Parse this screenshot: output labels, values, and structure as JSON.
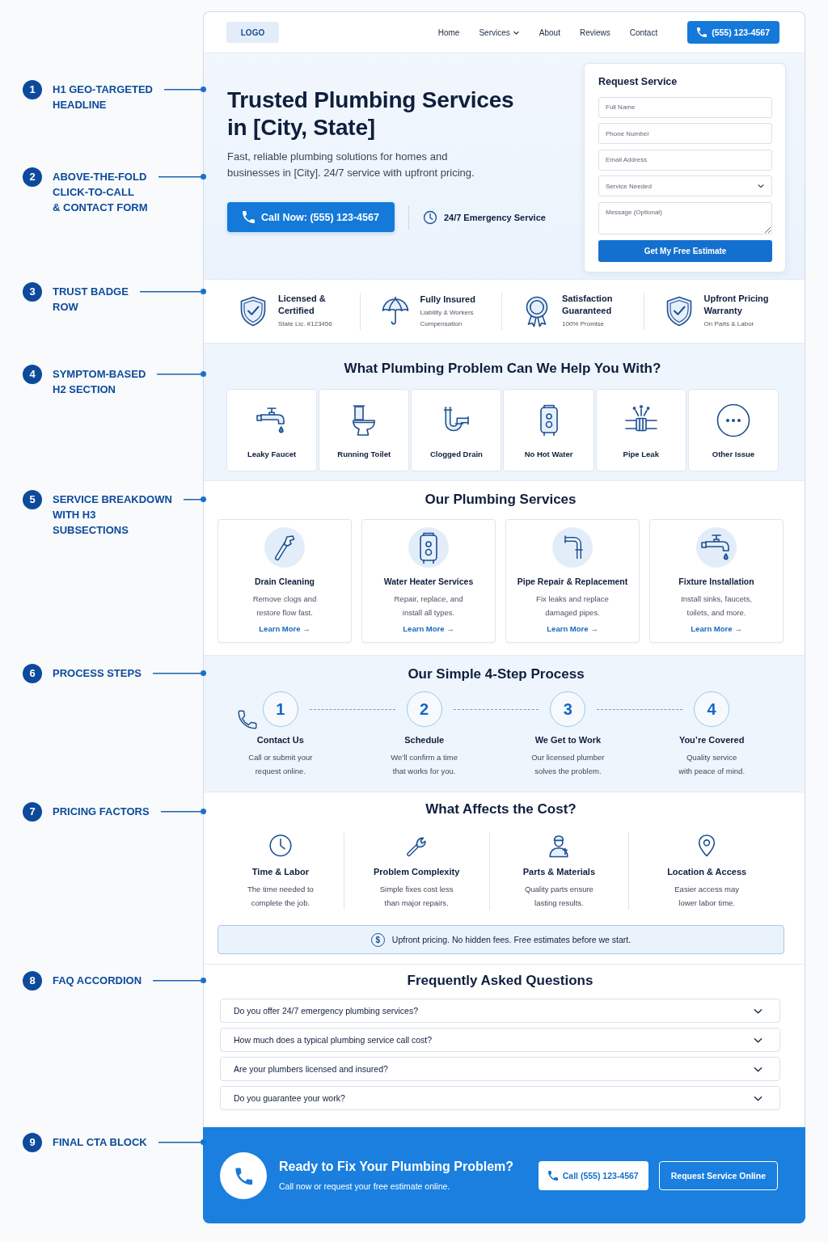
{
  "header": {
    "logo": "LOGO",
    "nav": [
      {
        "label": "Home",
        "has_menu": false
      },
      {
        "label": "Services",
        "has_menu": true
      },
      {
        "label": "About",
        "has_menu": false
      },
      {
        "label": "Reviews",
        "has_menu": false
      },
      {
        "label": "Contact",
        "has_menu": false
      }
    ],
    "phone_button": "(555) 123-4567"
  },
  "hero": {
    "annotations": [
      {
        "number": "1",
        "label": "H1 GEO-TARGETED\nHEADLINE"
      },
      {
        "number": "2",
        "label": "ABOVE-THE-FOLD\nCLICK-TO-CALL\n& CONTACT FORM"
      }
    ],
    "headline": "Trusted Plumbing Services\nin [City, State]",
    "subheadline": "Fast, reliable plumbing solutions for homes and\nbusinesses in [City]. 24/7 service with upfront pricing.",
    "call_button": "Call Now: (555) 123-4567",
    "emergency_note": "24/7 Emergency Service",
    "form": {
      "title": "Request Service",
      "fields": [
        {
          "kind": "input",
          "placeholder": "Full Name"
        },
        {
          "kind": "input",
          "placeholder": "Phone Number"
        },
        {
          "kind": "input",
          "placeholder": "Email Address"
        },
        {
          "kind": "select",
          "placeholder": "Service Needed"
        },
        {
          "kind": "textarea",
          "placeholder": "Message (Optional)"
        }
      ],
      "submit": "Get My Free Estimate"
    }
  },
  "trust_badges": {
    "annotation": {
      "number": "3",
      "label": "TRUST BADGE\nROW"
    },
    "items": [
      {
        "title": "Licensed &\nCertified",
        "subtitle": "State Lic. #123456"
      },
      {
        "title": "Fully Insured",
        "subtitle": "Liability & Workers\nCompensation"
      },
      {
        "title": "Satisfaction\nGuaranteed",
        "subtitle": "100% Promise"
      },
      {
        "title": "Upfront Pricing\nWarranty",
        "subtitle": "On Parts & Labor"
      }
    ]
  },
  "problems": {
    "annotation": {
      "number": "4",
      "label": "SYMPTOM-BASED\nH2 SECTION"
    },
    "title": "What Plumbing Problem Can We Help You With?",
    "items": [
      "Leaky Faucet",
      "Running Toilet",
      "Clogged Drain",
      "No Hot Water",
      "Pipe Leak",
      "Other Issue"
    ]
  },
  "services": {
    "annotation": {
      "number": "5",
      "label": "SERVICE BREAKDOWN\nWITH H3\nSUBSECTIONS"
    },
    "title": "Our Plumbing Services",
    "cards": [
      {
        "title": "Drain Cleaning",
        "description": "Remove clogs and\nrestore flow fast.",
        "link": "Learn More →"
      },
      {
        "title": "Water Heater Services",
        "description": "Repair, replace, and\ninstall all types.",
        "link": "Learn More →"
      },
      {
        "title": "Pipe Repair & Replacement",
        "description": "Fix leaks and replace\ndamaged pipes.",
        "link": "Learn More →"
      },
      {
        "title": "Fixture Installation",
        "description": "Install sinks, faucets,\ntoilets, and more.",
        "link": "Learn More →"
      }
    ]
  },
  "process": {
    "annotation": {
      "number": "6",
      "label": "PROCESS STEPS"
    },
    "title": "Our Simple 4-Step Process",
    "steps": [
      {
        "number": "1",
        "title": "Contact Us",
        "description": "Call or submit your\nrequest online."
      },
      {
        "number": "2",
        "title": "Schedule",
        "description": "We’ll confirm a time\nthat works for you."
      },
      {
        "number": "3",
        "title": "We Get to Work",
        "description": "Our licensed plumber\nsolves the problem."
      },
      {
        "number": "4",
        "title": "You’re Covered",
        "description": "Quality service\nwith peace of mind."
      }
    ]
  },
  "pricing": {
    "annotation": {
      "number": "7",
      "label": "PRICING FACTORS"
    },
    "title": "What Affects the Cost?",
    "factors": [
      {
        "title": "Time & Labor",
        "description": "The time needed to\ncomplete the job."
      },
      {
        "title": "Problem Complexity",
        "description": "Simple fixes cost less\nthan major repairs."
      },
      {
        "title": "Parts & Materials",
        "description": "Quality parts ensure\nlasting results."
      },
      {
        "title": "Location & Access",
        "description": "Easier access may\nlower labor time."
      }
    ],
    "note_symbol": "$",
    "note": "Upfront pricing. No hidden fees. Free estimates before we start."
  },
  "faq": {
    "annotation": {
      "number": "8",
      "label": "FAQ ACCORDION"
    },
    "title": "Frequently Asked Questions",
    "questions": [
      {
        "question": "Do you offer 24/7 emergency plumbing services?",
        "expanded": false
      },
      {
        "question": "How much does a typical plumbing service call cost?",
        "expanded": false
      },
      {
        "question": "Are your plumbers licensed and insured?",
        "expanded": false
      },
      {
        "question": "Do you guarantee your work?",
        "expanded": false
      }
    ]
  },
  "cta": {
    "annotation": {
      "number": "9",
      "label": "FINAL CTA BLOCK"
    },
    "title": "Ready to Fix Your Plumbing Problem?",
    "subtitle": "Call now or request your free estimate online.",
    "call_button": "Call (555) 123-4567",
    "request_button": "Request Service Online"
  }
}
